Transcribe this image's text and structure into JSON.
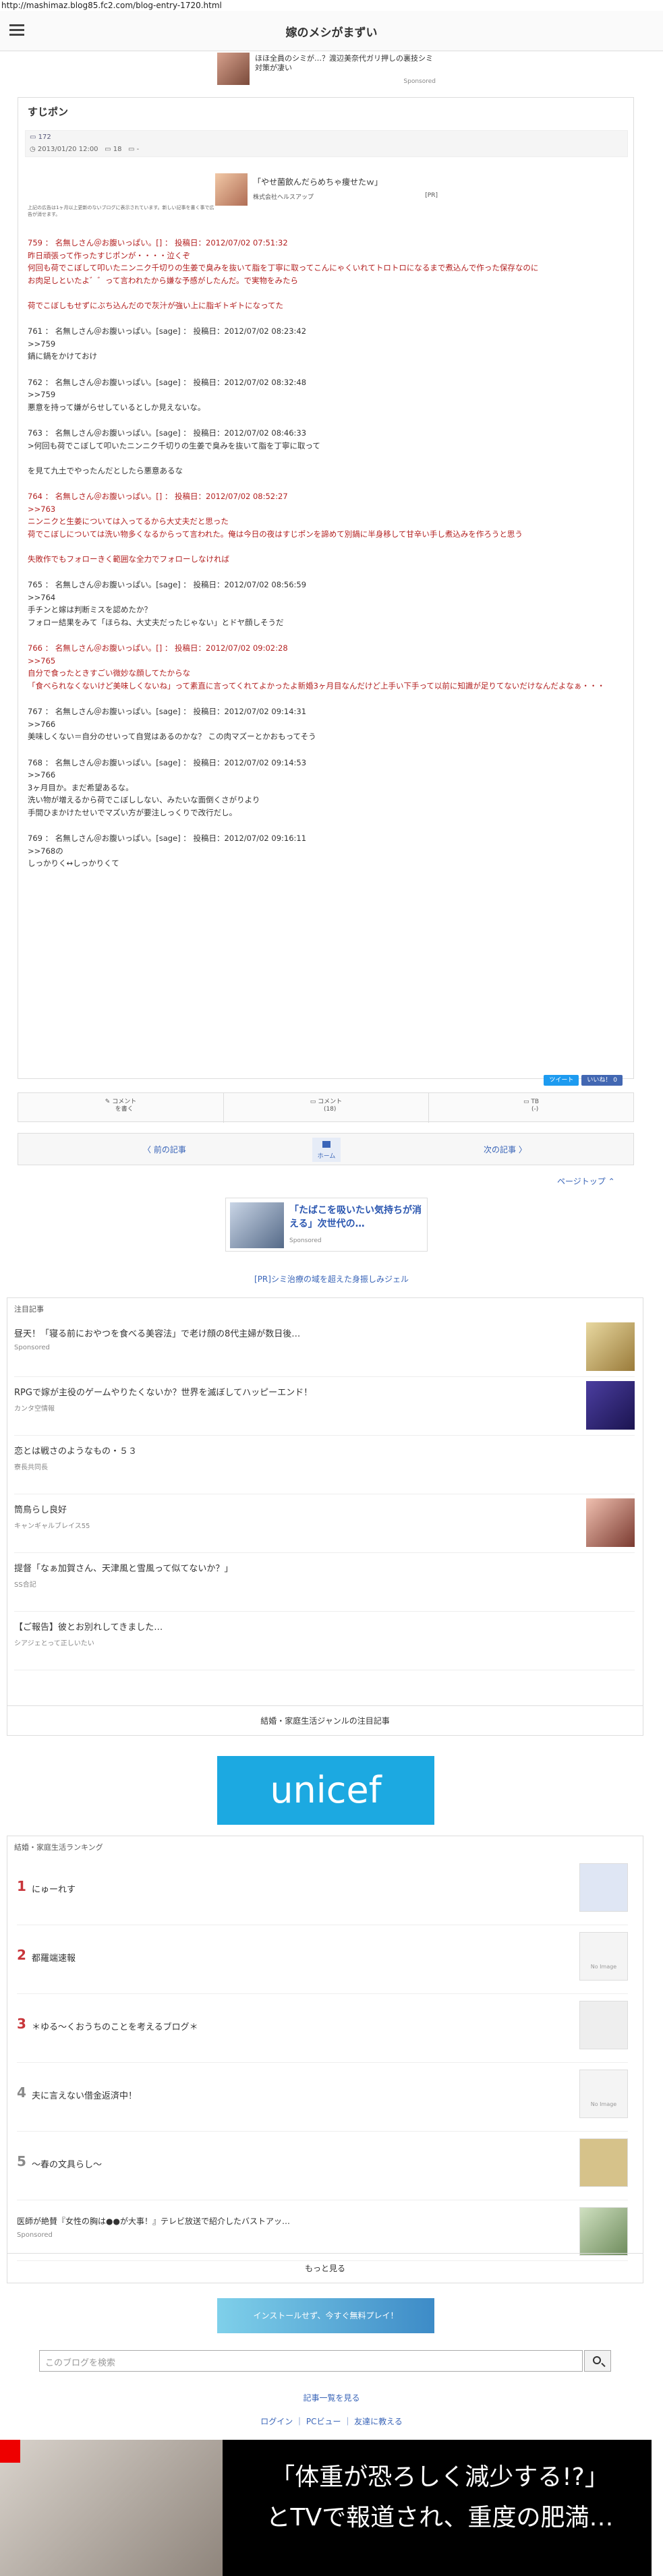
{
  "browser": {
    "url": "http://mashimaz.blog85.fc2.com/blog-entry-1720.html"
  },
  "header": {
    "blog_title": "嫁のメシがまずい"
  },
  "top_ad": {
    "text": "ほほ全員のシミが…？渡辺美奈代ガリ押しの裏技シミ対策が凄い",
    "label": "Sponsored"
  },
  "article": {
    "title": "すじポン",
    "category": "172",
    "date": "2013/01/20 12:00",
    "comments": "18",
    "trackbacks": "-",
    "ad": {
      "title": "「やせ菌飲んだらめちゃ痩せたｗ」",
      "company": "株式会社ヘルスアップ",
      "pr": "[PR]"
    },
    "note": "上記の広告は1ヶ月以上更新のないブログに表示されています。新しい記事を書く事で広告が消せます。",
    "posts": [
      {
        "style": "red",
        "lines": [
          "759 ： 名無しさん＠お腹いっぱい。[] ： 投稿日：2012/07/02 07:51:32",
          "昨日頑張って作ったすじポンが・・・・泣くぞ",
          "何回も荷でこぼして叩いたニンニク千切りの生姜で臭みを抜いて脂を丁寧に取ってこんにゃくいれてトロトロになるまで煮込んで作った保存なのに",
          "お肉足しといたよ゛゛って言われたから嫌な予感がしたんだ。で実物をみたら",
          "",
          "荷でこぼしもせずにぶち込んだので灰汁が強い上に脂ギトギトになってた"
        ]
      },
      {
        "style": "blk",
        "lines": [
          "761 ： 名無しさん＠お腹いっぱい。[sage] ： 投稿日：2012/07/02 08:23:42",
          ">>759",
          "鍋に鍋をかけておけ"
        ]
      },
      {
        "style": "blk",
        "lines": [
          "762 ： 名無しさん＠お腹いっぱい。[sage] ： 投稿日：2012/07/02 08:32:48",
          ">>759",
          "悪意を持って嫌がらせしているとしか見えないな。"
        ]
      },
      {
        "style": "blk",
        "lines": [
          "763 ： 名無しさん＠お腹いっぱい。[sage] ： 投稿日：2012/07/02 08:46:33",
          ">何回も荷でこぼして叩いたニンニク千切りの生姜で臭みを抜いて脂を丁寧に取って",
          "",
          "を見て九土でやったんだとしたら悪意あるな"
        ]
      },
      {
        "style": "red",
        "lines": [
          "764 ： 名無しさん＠お腹いっぱい。[] ： 投稿日：2012/07/02 08:52:27",
          ">>763",
          "ニンニクと生姜については入ってるから大丈夫だと思った",
          "荷でこぼしについては洗い物多くなるからって言われた。俺は今日の夜はすじポンを諦めて別鍋に半身移して甘辛い手し煮込みを作ろうと思う",
          "",
          "失敗作でもフォローきく範囲な全力でフォローしなければ"
        ]
      },
      {
        "style": "blk",
        "lines": [
          "765 ： 名無しさん＠お腹いっぱい。[sage] ： 投稿日：2012/07/02 08:56:59",
          ">>764",
          "手チンと嫁は判断ミスを認めたか？",
          "フォロー結果をみて「ほらね、大丈夫だったじゃない」とドヤ顔しそうだ"
        ]
      },
      {
        "style": "red",
        "lines": [
          "766 ： 名無しさん＠お腹いっぱい。[] ： 投稿日：2012/07/02 09:02:28",
          ">>765",
          "自分で食ったときすごい微妙な顔してたからな",
          "「食べられなくないけど美味しくないね」って素直に言ってくれてよかったよ新婚3ヶ月目なんだけど上手い下手って以前に知識が足りてないだけなんだよなぁ・・・"
        ]
      },
      {
        "style": "blk",
        "lines": [
          "767 ： 名無しさん＠お腹いっぱい。[sage] ： 投稿日：2012/07/02 09:14:31",
          ">>766",
          "美味しくない＝自分のせいって自覚はあるのかな？ この肉マズーとかおもってそう"
        ]
      },
      {
        "style": "blk",
        "lines": [
          "768 ： 名無しさん＠お腹いっぱい。[sage] ： 投稿日：2012/07/02 09:14:53",
          ">>766",
          "3ヶ月目か。まだ希望あるな。",
          "洗い物が増えるから荷でこぼししない、みたいな面倒くさがりより",
          "手間ひまかけたせいでマズい方が要注しっくりで改行だし。"
        ]
      },
      {
        "style": "blk",
        "lines": [
          "769 ： 名無しさん＠お腹いっぱい。[sage] ： 投稿日：2012/07/02 09:16:11",
          ">>768の",
          "しっかりく↔しっかりくて"
        ]
      }
    ],
    "share": {
      "tweet": "ツイート",
      "like": "いいね！ 0"
    }
  },
  "comment_bar": {
    "write": "コメント\nを書く",
    "count_label": "コメント\n(18)",
    "tb_label": "TB\n(-)"
  },
  "nav": {
    "prev": "〈 前の記事",
    "home": "ホーム",
    "next": "次の記事 〉",
    "pagetop": "ページトップ ⌃"
  },
  "bottom_ad": {
    "text": "「たばこを吸いたい気持ちが消える」次世代の…",
    "label": "Sponsored"
  },
  "pr_link": "[PR]シミ治療の域を超えた身振しみジェル",
  "attention": {
    "heading": "注目記事",
    "items": [
      {
        "title": "昼天！「寝る前におやつを食べる美容法」で老け顔の8代主婦が数日後…",
        "sub": "Sponsored"
      },
      {
        "title": "RPGで嫁が主役のゲームやりたくないか？世界を滅ぼしてハッピーエンド！",
        "sub": "カンタ空情報"
      },
      {
        "title": "恋とは戦さのようなもの・５３",
        "sub": "寮長共同長"
      },
      {
        "title": "筒鳥らし良好",
        "sub": "キャンギャルブレイス55"
      },
      {
        "title": "提督「なぁ加賀さん、天津風と雪風って似てないか？」",
        "sub": "SS合記"
      },
      {
        "title": "【ご報告】彼とお別れしてきました…",
        "sub": "シアジェとって正しいたい"
      }
    ],
    "more": "結婚・家庭生活ジャンルの注目記事"
  },
  "unicef": "unicef",
  "ranking": {
    "heading": "結婚・家庭生活ランキング",
    "items": [
      {
        "rank": "1",
        "title": "にゅーれす",
        "color": "#c8353a"
      },
      {
        "rank": "2",
        "title": "都羅端速報",
        "color": "#c8353a"
      },
      {
        "rank": "3",
        "title": "＊ゆる～くおうちのことを考えるブログ＊",
        "color": "#c8353a"
      },
      {
        "rank": "4",
        "title": "夫に言えない借金返済中！",
        "color": "#8a8a8a"
      },
      {
        "rank": "5",
        "title": "～春の文具らし～",
        "color": "#8a8a8a"
      }
    ],
    "sponsored": {
      "title": "医師が絶賛『女性の胸は●●が大事！』テレビ放送で紹介したバストアッ…",
      "sub": "Sponsored"
    },
    "no_image": "No Image",
    "more": "もっと見る"
  },
  "banner2": "インストールせず、今すぐ無料プレイ！",
  "search": {
    "placeholder": "このブログを検索"
  },
  "entry_list": "記事一覧を見る",
  "footer_links": "ログイン ｜ PCビュー ｜ 友達に教える",
  "big_ad": {
    "line1": "「体重が恐ろしく減少する!?」",
    "line2": "とTVで報道され、重度の肥満…"
  }
}
